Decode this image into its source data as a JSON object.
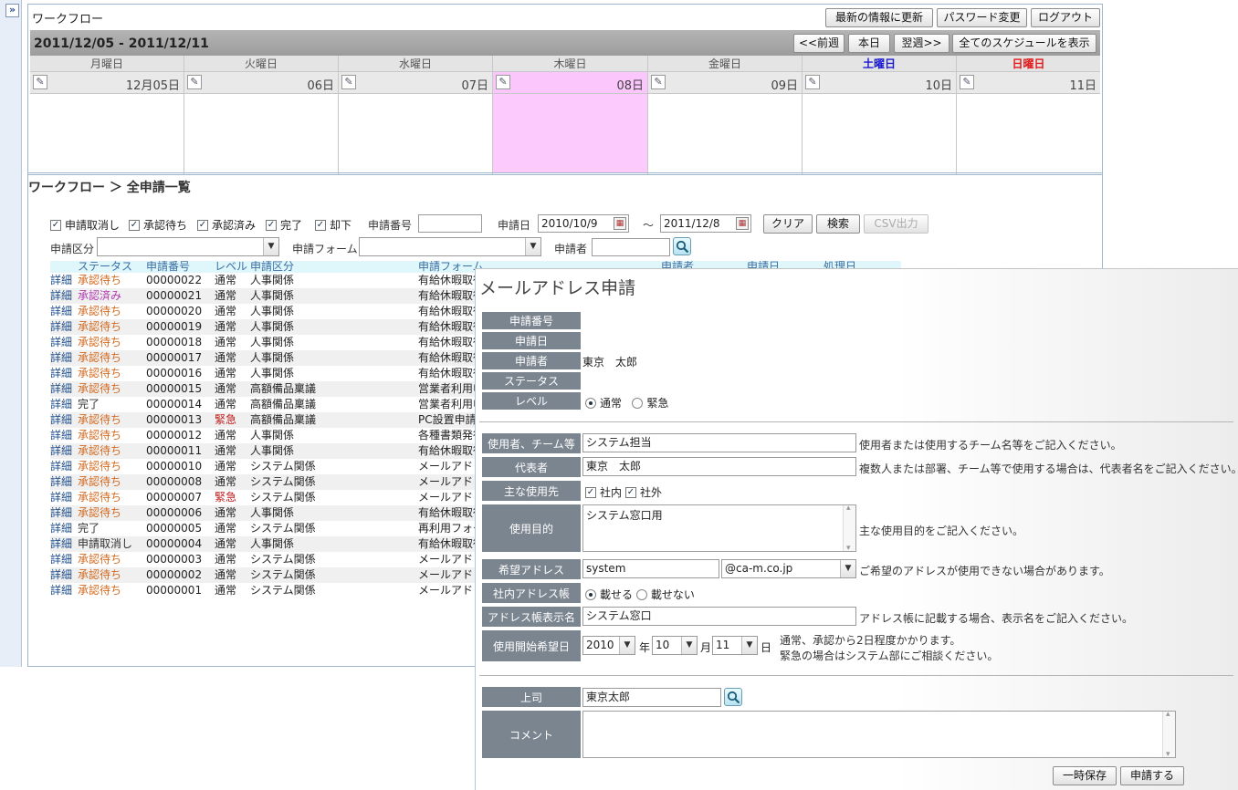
{
  "app": {
    "title": "ワークフロー",
    "toggle_label": "»",
    "refresh_label": "最新の情報に更新",
    "password_label": "パスワード変更",
    "logout_label": "ログアウト"
  },
  "calendar": {
    "range": "2011/12/05 - 2011/12/11",
    "prev_label": "<<前週",
    "today_label": "本日",
    "next_label": "翌週>>",
    "all_label": "全てのスケジュールを表示",
    "days": [
      {
        "name": "月曜日",
        "date": "12月05日"
      },
      {
        "name": "火曜日",
        "date": "06日"
      },
      {
        "name": "水曜日",
        "date": "07日"
      },
      {
        "name": "木曜日",
        "date": "08日"
      },
      {
        "name": "金曜日",
        "date": "09日"
      },
      {
        "name": "土曜日",
        "date": "10日"
      },
      {
        "name": "日曜日",
        "date": "11日"
      }
    ]
  },
  "list": {
    "breadcrumb": "ワークフロー ＞ 全申請一覧",
    "filters": {
      "statuses": [
        "申請取消し",
        "承認待ち",
        "承認済み",
        "完了",
        "却下"
      ],
      "number_label": "申請番号",
      "date_label": "申請日",
      "date_from": "2010/10/9",
      "tilde": "～",
      "date_to": "2011/12/8",
      "clear_label": "クリア",
      "search_label": "検索",
      "csv_label": "CSV出力",
      "category_label": "申請区分",
      "form_label": "申請フォーム",
      "applicant_label": "申請者"
    },
    "headers": [
      "ステータス",
      "申請番号",
      "レベル",
      "申請区分",
      "申請フォーム",
      "申請者",
      "申請日",
      "処理日"
    ],
    "detail_label": "詳細",
    "rows": [
      {
        "status": "承認待ち",
        "number": "00000022",
        "level": "通常",
        "category": "人事関係",
        "form": "有給休暇取得"
      },
      {
        "status": "承認済み",
        "number": "00000021",
        "level": "通常",
        "category": "人事関係",
        "form": "有給休暇取得"
      },
      {
        "status": "承認待ち",
        "number": "00000020",
        "level": "通常",
        "category": "人事関係",
        "form": "有給休暇取得"
      },
      {
        "status": "承認待ち",
        "number": "00000019",
        "level": "通常",
        "category": "人事関係",
        "form": "有給休暇取得"
      },
      {
        "status": "承認待ち",
        "number": "00000018",
        "level": "通常",
        "category": "人事関係",
        "form": "有給休暇取得"
      },
      {
        "status": "承認待ち",
        "number": "00000017",
        "level": "通常",
        "category": "人事関係",
        "form": "有給休暇取得"
      },
      {
        "status": "承認待ち",
        "number": "00000016",
        "level": "通常",
        "category": "人事関係",
        "form": "有給休暇取得"
      },
      {
        "status": "承認待ち",
        "number": "00000015",
        "level": "通常",
        "category": "高額備品稟議",
        "form": "営業者利用申請"
      },
      {
        "status": "完了",
        "number": "00000014",
        "level": "通常",
        "category": "高額備品稟議",
        "form": "営業者利用申請"
      },
      {
        "status": "承認待ち",
        "number": "00000013",
        "level": "緊急",
        "category": "高額備品稟議",
        "form": "PC設置申請"
      },
      {
        "status": "承認待ち",
        "number": "00000012",
        "level": "通常",
        "category": "人事関係",
        "form": "各種書類発行"
      },
      {
        "status": "承認待ち",
        "number": "00000011",
        "level": "通常",
        "category": "人事関係",
        "form": "有給休暇取得"
      },
      {
        "status": "承認待ち",
        "number": "00000010",
        "level": "通常",
        "category": "システム関係",
        "form": "メールアドレス"
      },
      {
        "status": "承認待ち",
        "number": "00000008",
        "level": "通常",
        "category": "システム関係",
        "form": "メールアドレス"
      },
      {
        "status": "承認待ち",
        "number": "00000007",
        "level": "緊急",
        "category": "システム関係",
        "form": "メールアドレス"
      },
      {
        "status": "承認待ち",
        "number": "00000006",
        "level": "通常",
        "category": "人事関係",
        "form": "有給休暇取得"
      },
      {
        "status": "完了",
        "number": "00000005",
        "level": "通常",
        "category": "システム関係",
        "form": "再利用フォーム"
      },
      {
        "status": "申請取消し",
        "number": "00000004",
        "level": "通常",
        "category": "人事関係",
        "form": "有給休暇取得"
      },
      {
        "status": "承認待ち",
        "number": "00000003",
        "level": "通常",
        "category": "システム関係",
        "form": "メールアドレス"
      },
      {
        "status": "承認待ち",
        "number": "00000002",
        "level": "通常",
        "category": "システム関係",
        "form": "メールアドレス"
      },
      {
        "status": "承認待ち",
        "number": "00000001",
        "level": "通常",
        "category": "システム関係",
        "form": "メールアドレス"
      }
    ]
  },
  "form": {
    "title": "メールアドレス申請",
    "number_label": "申請番号",
    "date_label": "申請日",
    "applicant_label": "申請者",
    "applicant_value": "東京　太郎",
    "status_label": "ステータス",
    "level_label": "レベル",
    "level_normal": "通常",
    "level_urgent": "緊急",
    "user_label": "使用者、チーム等",
    "user_value": "システム担当",
    "user_hint": "使用者または使用するチーム名等をご記入ください。",
    "rep_label": "代表者",
    "rep_value": "東京　太郎",
    "rep_hint": "複数人または部署、チーム等で使用する場合は、代表者名をご記入ください。",
    "usage_label": "主な使用先",
    "usage_internal": "社内",
    "usage_external": "社外",
    "purpose_label": "使用目的",
    "purpose_value": "システム窓口用",
    "purpose_hint": "主な使用目的をご記入ください。",
    "addr_label": "希望アドレス",
    "addr_value": "system",
    "domain_value": "@ca-m.co.jp",
    "addr_hint": "ご希望のアドレスが使用できない場合があります。",
    "book_label": "社内アドレス帳",
    "book_yes": "載せる",
    "book_no": "載せない",
    "display_label": "アドレス帳表示名",
    "display_value": "システム窓口",
    "display_hint": "アドレス帳に記載する場合、表示名をご記入ください。",
    "start_label": "使用開始希望日",
    "year_value": "2010",
    "year_unit": "年",
    "month_value": "10",
    "month_unit": "月",
    "day_value": "11",
    "day_unit": "日",
    "start_hint1": "通常、承認から2日程度かかります。",
    "start_hint2": "緊急の場合はシステム部にご相談ください。",
    "boss_label": "上司",
    "boss_value": "東京太郎",
    "comment_label": "コメント",
    "save_label": "一時保存",
    "submit_label": "申請する"
  },
  "colors": {
    "saturday": "#1a1ad0",
    "sunday": "#e01a1a",
    "today_bg": "#fdcafd",
    "label_bg": "#7b8590",
    "status_wait": "#d2691e",
    "status_approved": "#b03cb0",
    "urgent": "#c01a1a"
  }
}
